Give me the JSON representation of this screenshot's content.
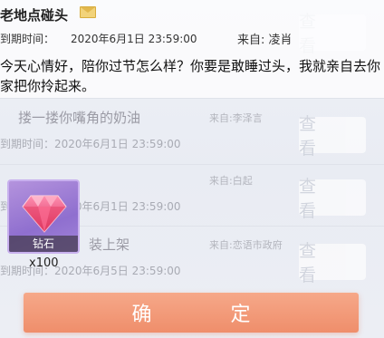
{
  "mail_list": [
    {
      "title": "",
      "due": "",
      "from": "",
      "view_label": "查 看"
    },
    {
      "title": "搂一搂你嘴角的奶油",
      "due": "到期时间：2020年6月1日 23:59:00",
      "from": "来自:李泽言",
      "view_label": "查 看"
    },
    {
      "title": "",
      "due": "到期时间：2020年6月1日 23:59:00",
      "from": "来自:白起",
      "view_label": "查 看"
    },
    {
      "title": "装上架",
      "due": "到期时间：2020年6月5日 23:59:00",
      "from": "来自:恋语市政府",
      "view_label": "查 看"
    }
  ],
  "detail": {
    "title": "老地点碰头",
    "due_label": "到期时间：",
    "due_value": "2020年6月1日 23:59:00",
    "from": "来自: 凌肖",
    "body": "今天心情好，陪你过节怎么样？你要是敢睡过头，我就亲自去你家把你拎起来。"
  },
  "attachment": {
    "name": "钻石",
    "quantity": "x100",
    "icon": "diamond-icon"
  },
  "confirm_label": "确 定",
  "colors": {
    "confirm_button": "#ef8e6b",
    "item_bg": "#9f7fd6",
    "gem": "#e8436a"
  }
}
